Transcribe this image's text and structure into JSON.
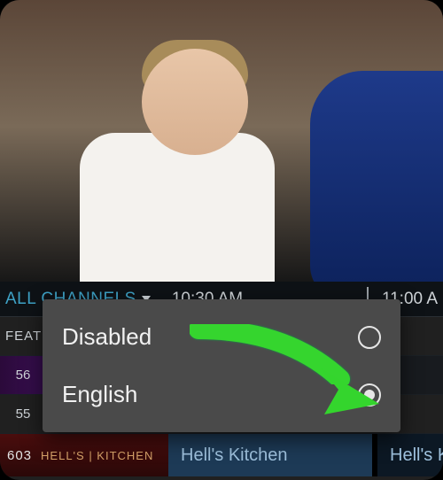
{
  "timeline": {
    "filter_label": "ALL CHANNELS",
    "time_1": "10:30 AM",
    "time_2": "11:00 A"
  },
  "rows": {
    "featured_label": "FEAT",
    "ch56": "56",
    "ch55": "55"
  },
  "row603": {
    "ch_num": "603",
    "ch_brand": "HELL'S | KITCHEN",
    "prog1": "Hell's Kitchen",
    "prog2": "Hell's K"
  },
  "popup": {
    "options": [
      {
        "label": "Disabled",
        "selected": false
      },
      {
        "label": "English",
        "selected": true
      }
    ]
  },
  "annotation": {
    "arrow_color": "#34d52d"
  }
}
